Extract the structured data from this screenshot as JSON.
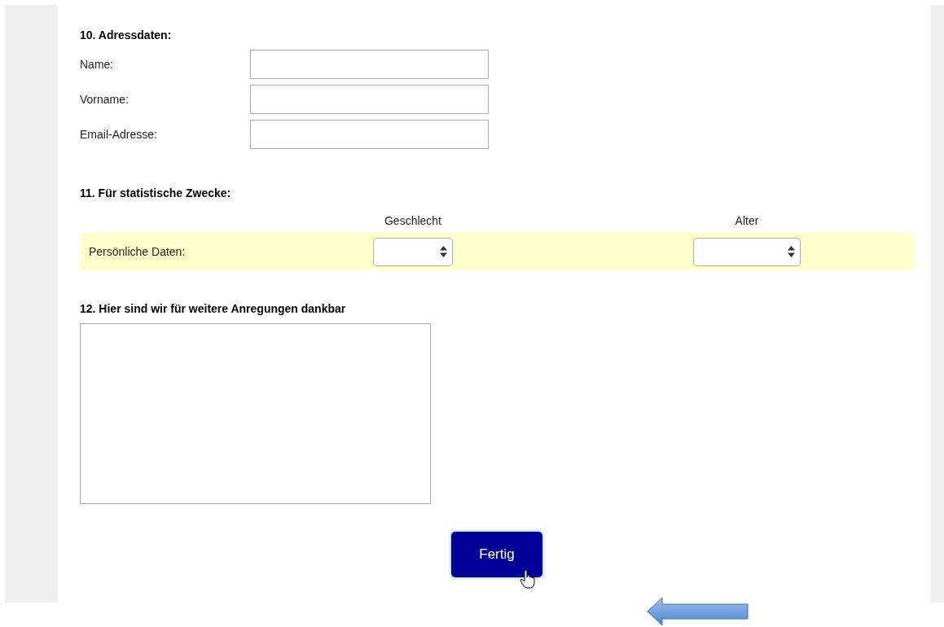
{
  "address": {
    "heading": "10. Adressdaten:",
    "fields": [
      {
        "label": "Name:"
      },
      {
        "label": "Vorname:"
      },
      {
        "label": "Email-Adresse:"
      }
    ]
  },
  "statistics": {
    "heading": "11. Für statistische Zwecke:",
    "columns": [
      "Geschlecht",
      "Alter"
    ],
    "row_label": "Persönliche Daten:"
  },
  "suggestions": {
    "heading": "12. Hier sind wir für weitere Anregungen dankbar"
  },
  "submit_button": "Fertig"
}
